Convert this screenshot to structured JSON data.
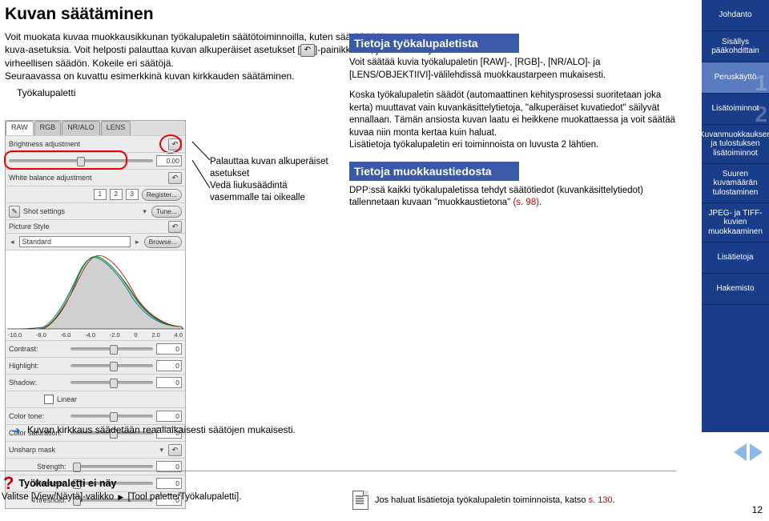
{
  "title": "Kuvan säätäminen",
  "intro_line1": "Voit muokata kuvaa muokkausikkunan työkalupaletin säätötoiminnoilla, kuten säätää kirkkautta tai kuva-asetuksia. Voit helposti palauttaa kuvan alkuperäiset asetukset [",
  "intro_line1b": "]-painikkeella, jos olet tehnyt virheellisen säädön. Kokeile eri säätöjä.",
  "intro_line2": "Seuraavassa on kuvattu esimerkkinä kuvan kirkkauden säätäminen.",
  "tool_palette_label": "Työkalupaletti",
  "callout": {
    "line1": "Palauttaa kuvan alkuperäiset asetukset",
    "line2": "Vedä liukusäädintä vasemmalle tai oikealle"
  },
  "palette": {
    "tabs": [
      "RAW",
      "RGB",
      "NR/ALO",
      "LENS"
    ],
    "brightness_label": "Brightness adjustment",
    "brightness_val": "0.00",
    "wb_label": "White balance adjustment",
    "wb_nums": [
      "1",
      "2",
      "3"
    ],
    "register": "Register...",
    "shot_settings": "Shot settings",
    "tune": "Tune...",
    "picture_style_label": "Picture Style",
    "standard": "Standard",
    "browse": "Browse...",
    "axis": [
      "-10.0",
      "-8.0",
      "-6.0",
      "-4.0",
      "-2.0",
      "0",
      "2.0",
      "4.0"
    ],
    "contrast": "Contrast:",
    "highlight": "Highlight:",
    "shadow": "Shadow:",
    "linear": "Linear",
    "color_tone": "Color tone:",
    "color_sat": "Color saturation:",
    "unsharp_label": "Unsharp mask",
    "strength": "Strength:",
    "fineness": "Fineness:",
    "threshold": "Threshold:",
    "zero": "0"
  },
  "right": {
    "h1": "Tietoja työkalupaletista",
    "p1": "Voit säätää kuvia työkalupaletin [RAW]-, [RGB]-, [NR/ALO]- ja [LENS/OBJEKTIIVI]-välilehdissä muokkaustarpeen mukaisesti.",
    "p2a": "Koska työkalupaletin säädöt (automaattinen kehitysprosessi suoritetaan joka kerta) muuttavat vain kuvankäsittelytietoja, \"alkuperäiset kuvatiedot\" säilyvät ennallaan. Tämän ansiosta kuvan laatu ei heikkene muokattaessa ja voit säätää kuvaa niin monta kertaa kuin haluat.",
    "p2b": "Lisätietoja työkalupaletin eri toiminnoista on luvusta 2 lähtien.",
    "h2": "Tietoja muokkaustiedosta",
    "p3a": "DPP:ssä kaikki työkalupaletissa tehdyt säätötiedot (kuvankäsittelytiedot) tallennetaan kuvaan \"muokkaustietona\" ",
    "p3b": "(s. 98)",
    "p3c": "."
  },
  "footnote": "Kuvan kirkkaus säädetään reaaliaikaisesti säätöjen mukaisesti.",
  "bottom": {
    "q_title": "Työkalupaletti ei näy",
    "q_text1": "Valitse [View/Näytä]-valikko ",
    "q_text2": " [Tool palette/Työkalupaletti].",
    "info_text1": "Jos haluat lisätietoja työkalupaletin toiminnoista, katso ",
    "info_ref": "s. 130",
    "info_text2": "."
  },
  "sidebar": [
    {
      "label": "Johdanto"
    },
    {
      "label": "Sisällys pääkohdittain"
    },
    {
      "label": "Peruskäyttö",
      "n": "1"
    },
    {
      "label": "Lisätoiminnot",
      "n": "2"
    },
    {
      "label": "Kuvanmuokkauksen ja tulostuksen lisätoiminnot",
      "n": ""
    },
    {
      "label": "Suuren kuvamäärän tulostaminen",
      "n": ""
    },
    {
      "label": "JPEG- ja TIFF-kuvien muokkaaminen",
      "n": ""
    },
    {
      "label": "Lisätietoja"
    },
    {
      "label": "Hakemisto"
    }
  ],
  "page_number": "12"
}
